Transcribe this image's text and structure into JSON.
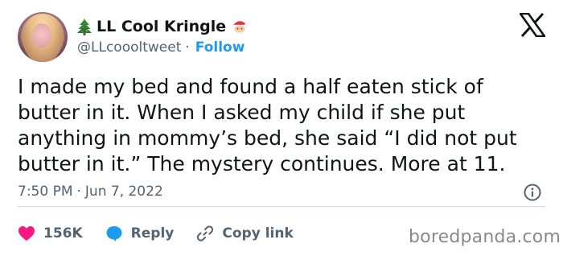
{
  "tweet": {
    "display_name": "LL Cool Kringle",
    "name_prefix_icon": "christmas-tree-icon",
    "name_suffix_icon": "santa-claus-icon",
    "handle": "@LLcoooltweet",
    "separator": "·",
    "follow_label": "Follow",
    "text": "I made my bed and found a half eaten stick of\nbutter in it. When I asked my child if she put\nanything in mommy’s bed, she said “I did not put\nbutter in it.” The mystery continues. More at 11.",
    "time": "7:50 PM",
    "date_separator": "·",
    "date": "Jun 7, 2022"
  },
  "actions": {
    "like_count": "156K",
    "reply_label": "Reply",
    "copy_link_label": "Copy link"
  },
  "brand": {
    "platform_icon": "x-logo-icon",
    "watermark": "boredpanda.com"
  },
  "colors": {
    "accent": "#1d9bf0",
    "like": "#f91880",
    "secondary_text": "#536471",
    "primary_text": "#0f1419"
  }
}
